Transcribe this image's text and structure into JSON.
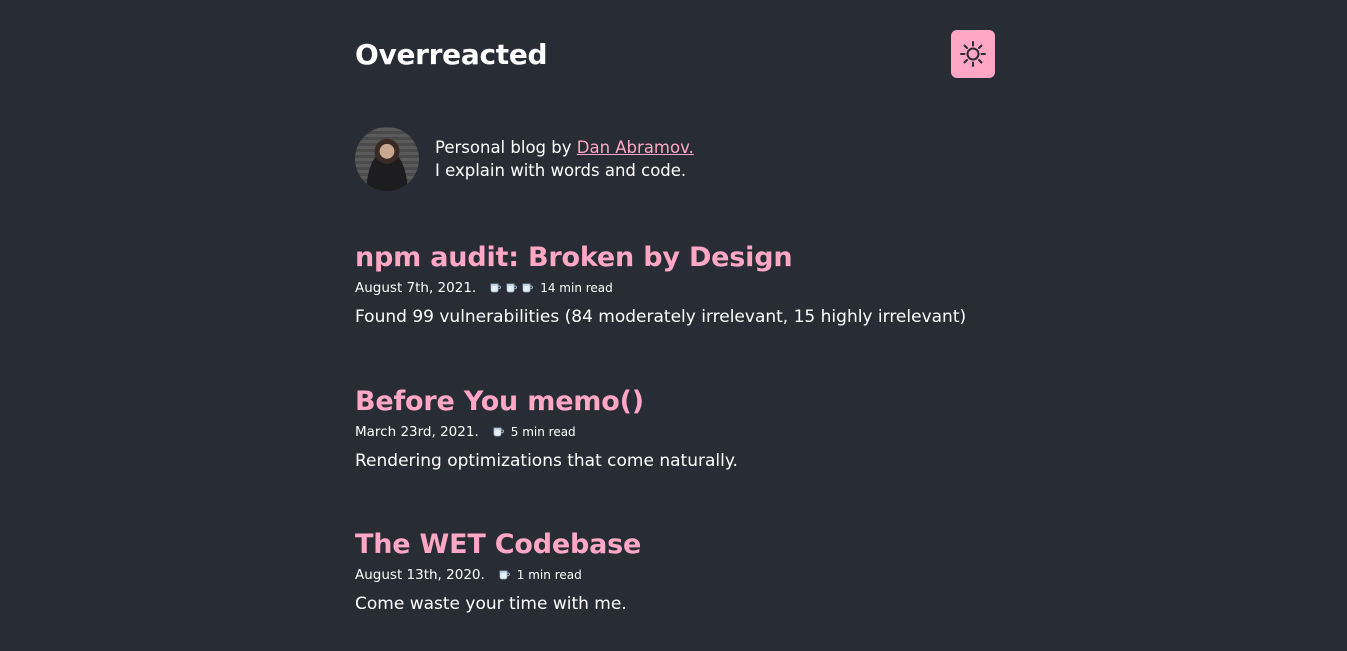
{
  "header": {
    "title": "Overreacted",
    "theme_toggle_icon": "sun-icon",
    "accent": "#ffa7c4"
  },
  "bio": {
    "prefix": "Personal blog by ",
    "author_link": "Dan Abramov.",
    "line2": "I explain with words and code."
  },
  "posts": [
    {
      "title": "npm audit: Broken by Design",
      "date": "August 7th, 2021.",
      "cups": 3,
      "read_time": "14 min read",
      "spoiler": "Found 99 vulnerabilities (84 moderately irrelevant, 15 highly irrelevant)"
    },
    {
      "title": "Before You memo()",
      "date": "March 23rd, 2021.",
      "cups": 1,
      "read_time": "5 min read",
      "spoiler": "Rendering optimizations that come naturally."
    },
    {
      "title": "The WET Codebase",
      "date": "August 13th, 2020.",
      "cups": 1,
      "read_time": "1 min read",
      "spoiler": "Come waste your time with me."
    }
  ]
}
